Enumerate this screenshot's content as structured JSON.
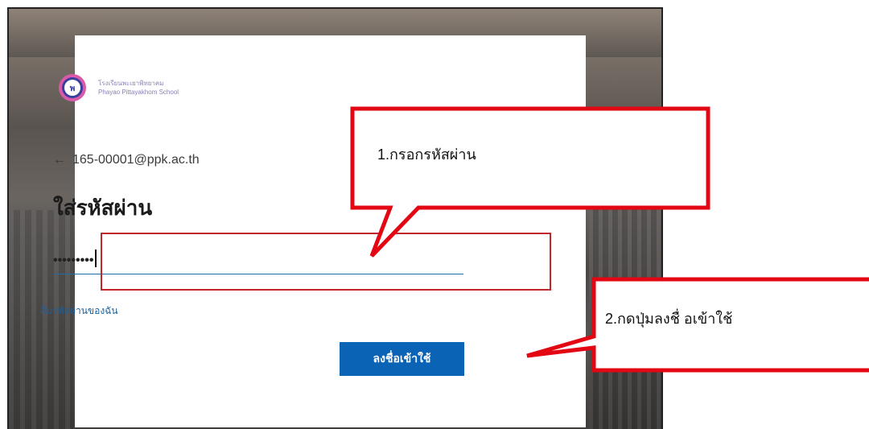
{
  "login": {
    "logo_line1": "โรงเรียนพะเยาพิทยาคม",
    "logo_line2": "Phayao Pittayakhom School",
    "account_email": "165-00001@ppk.ac.th",
    "back_arrow": "←",
    "heading": "ใส่รหัสผ่าน",
    "password_masked": "•••••••••",
    "forgot_link": "ลืมรหัสผ่านของฉัน",
    "signin_button": "ลงชื่อเข้าใช้"
  },
  "annotations": {
    "callout1_text": "1.กรอกรหัสผ่าน",
    "callout2_text": "2.กดปุ่มลงชื่ อเข้าใช้",
    "color": "#e30613"
  },
  "icons": [
    "school-logo-icon",
    "back-arrow-icon"
  ]
}
